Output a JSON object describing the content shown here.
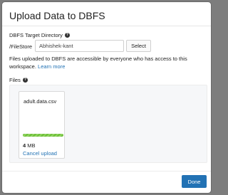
{
  "dialog": {
    "title": "Upload Data to DBFS"
  },
  "target_directory": {
    "label": "DBFS Target Directory",
    "help_icon": "help-circle-icon",
    "prefix": "/FileStore",
    "value": "Abhishek-kant",
    "select_label": "Select"
  },
  "info": {
    "text": "Files uploaded to DBFS are accessible by everyone who has access to this workspace.",
    "link_label": "Learn more"
  },
  "files": {
    "label": "Files",
    "help_icon": "help-circle-icon",
    "items": [
      {
        "name": "adult.data.csv",
        "progress": 1.0,
        "size_value": "4",
        "size_unit": "MB",
        "cancel_label": "Cancel upload"
      }
    ]
  },
  "footer": {
    "done_label": "Done"
  },
  "colors": {
    "accent": "#2272b4",
    "progress": "#6fbf3b",
    "overlay": "#7d7d7d"
  }
}
